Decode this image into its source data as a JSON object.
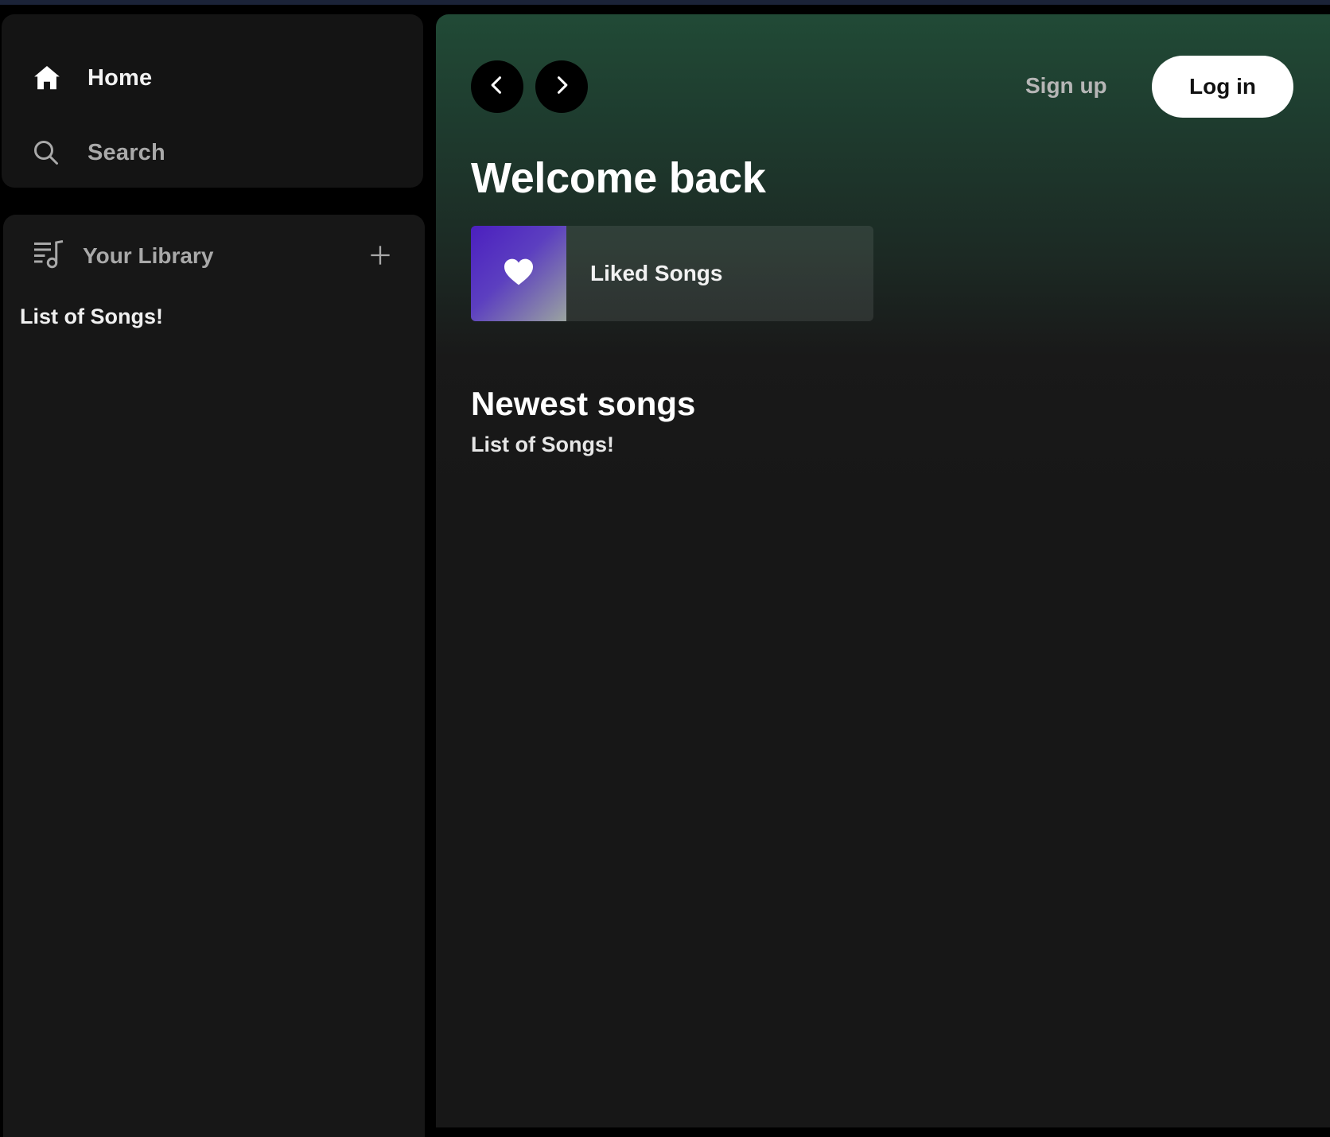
{
  "sidebar": {
    "nav": [
      {
        "label": "Home",
        "icon": "home-icon"
      },
      {
        "label": "Search",
        "icon": "search-icon"
      }
    ],
    "library": {
      "title": "Your Library",
      "icon": "library-icon",
      "add_icon": "plus-icon",
      "content_text": "List of Songs!"
    }
  },
  "header": {
    "back_icon": "chevron-left-icon",
    "forward_icon": "chevron-right-icon",
    "signup_label": "Sign up",
    "login_label": "Log in"
  },
  "main": {
    "greeting": "Welcome back",
    "liked_songs": {
      "label": "Liked Songs",
      "icon": "heart-icon"
    },
    "section": {
      "title": "Newest songs",
      "subtitle": "List of Songs!"
    }
  },
  "colors": {
    "background": "#000000",
    "panel": "#171717",
    "header_gradient_top": "#214a36",
    "liked_gradient_start": "#4b1fbf",
    "login_button": "#ffffff"
  }
}
